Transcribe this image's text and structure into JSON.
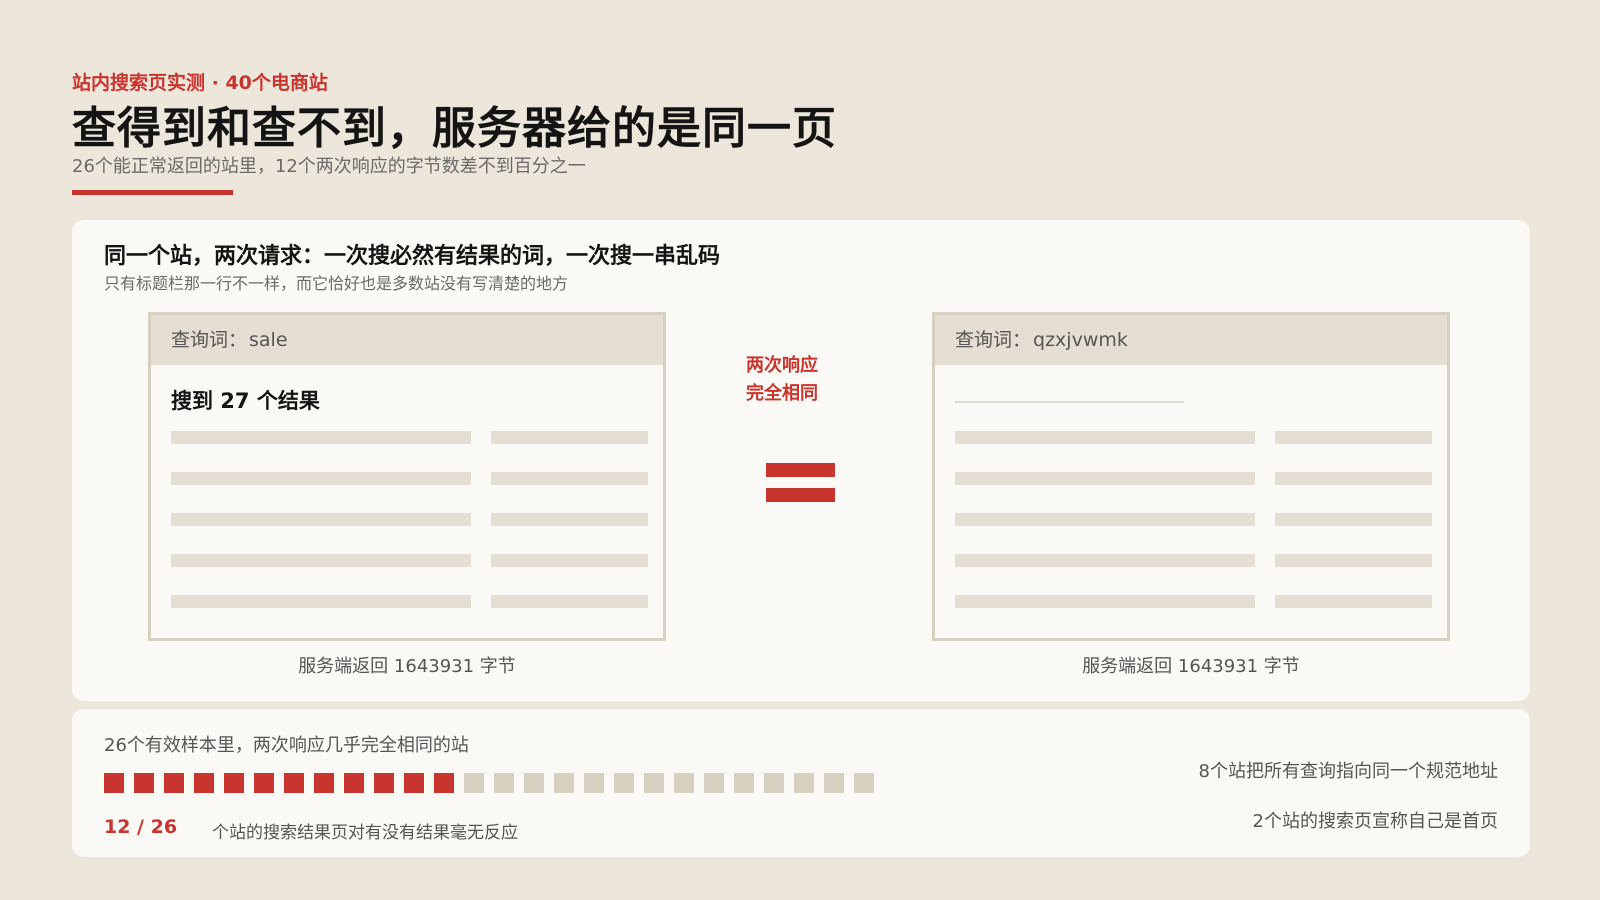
{
  "header": {
    "eyebrow": "站内搜索页实测 · 40个电商站",
    "title": "查得到和查不到，服务器给的是同一页",
    "subtitle": "26个能正常返回的站里，12个两次响应的字节数差不到百分之一"
  },
  "comparison": {
    "title": "同一个站，两次请求：一次搜必然有结果的词，一次搜一串乱码",
    "subtitle": "只有标题栏那一行不一样，而它恰好也是多数站没有写清楚的地方",
    "left": {
      "query_label": "查询词：",
      "query": "sale",
      "heading": "搜到 27 个结果",
      "caption": "服务端返回 1643931 字节"
    },
    "right": {
      "query_label": "查询词：",
      "query": "qzxjvwmk",
      "caption": "服务端返回 1643931 字节"
    },
    "equal_label_line1": "两次响应",
    "equal_label_line2": "完全相同"
  },
  "stats": {
    "label": "26个有效样本里，两次响应几乎完全相同的站",
    "identical": 12,
    "total": 26,
    "ratio": "12 / 26",
    "ratio_desc": "个站的搜索结果页对有没有结果毫无反应",
    "note1": "8个站把所有查询指向同一个规范地址",
    "note2": "2个站的搜索页宣称自己是首页"
  },
  "colors": {
    "accent": "#c8352f",
    "background": "#ece7da",
    "card": "#faf9f5",
    "muted_block": "#d7cfbf"
  }
}
